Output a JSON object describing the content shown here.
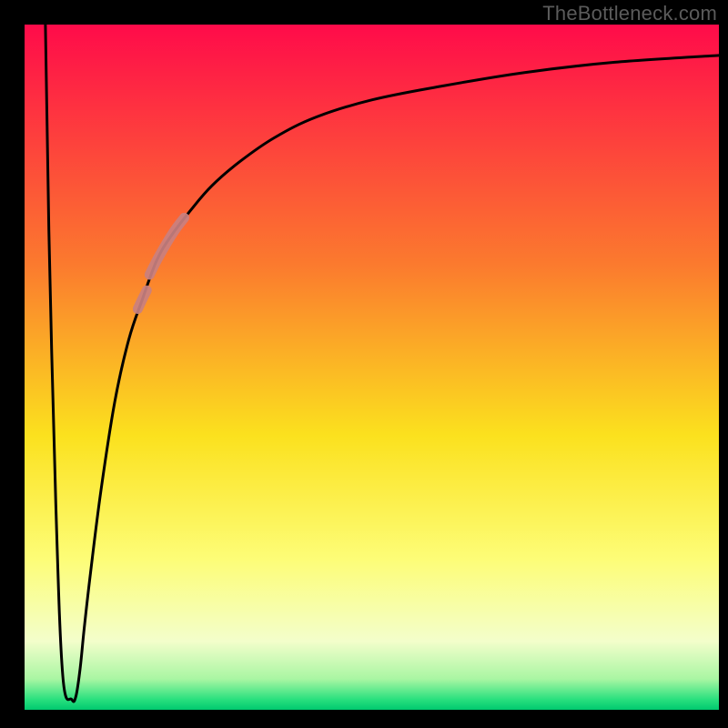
{
  "watermark": "TheBottleneck.com",
  "chart_data": {
    "type": "line",
    "title": "",
    "xlabel": "",
    "ylabel": "",
    "xlim": [
      0,
      100
    ],
    "ylim": [
      0,
      100
    ],
    "grid": false,
    "legend": false,
    "background_gradient_stops": [
      {
        "offset": 0.0,
        "color": "#ff0b4a"
      },
      {
        "offset": 0.35,
        "color": "#fb7a2e"
      },
      {
        "offset": 0.6,
        "color": "#fbe11e"
      },
      {
        "offset": 0.78,
        "color": "#fdfd77"
      },
      {
        "offset": 0.9,
        "color": "#f3fecb"
      },
      {
        "offset": 0.955,
        "color": "#a9f6a3"
      },
      {
        "offset": 0.985,
        "color": "#29e07e"
      },
      {
        "offset": 1.0,
        "color": "#00c96f"
      }
    ],
    "series": [
      {
        "name": "bottleneck-curve",
        "type": "line",
        "color": "#000000",
        "x": [
          3.0,
          3.5,
          4.5,
          5.5,
          6.8,
          7.4,
          8.0,
          8.6,
          9.5,
          11.0,
          13.0,
          15.0,
          17.0,
          19.0,
          21.0,
          24.0,
          27.0,
          31.0,
          36.0,
          42.0,
          50.0,
          60.0,
          72.0,
          85.0,
          100.0
        ],
        "y": [
          100.0,
          70.0,
          30.0,
          5.0,
          1.5,
          2.0,
          6.0,
          12.0,
          20.0,
          32.0,
          45.0,
          54.0,
          60.0,
          65.5,
          69.0,
          73.0,
          76.5,
          80.0,
          83.5,
          86.5,
          89.0,
          91.0,
          93.0,
          94.5,
          95.5
        ]
      },
      {
        "name": "highlight-segment-upper",
        "type": "line-thick",
        "color": "#c98080",
        "x": [
          18.0,
          19.0,
          20.0,
          21.0,
          22.0,
          23.0
        ],
        "y": [
          63.5,
          65.5,
          67.3,
          69.0,
          70.5,
          71.8
        ]
      },
      {
        "name": "highlight-segment-lower",
        "type": "line-thick",
        "color": "#c98080",
        "x": [
          16.3,
          17.0,
          17.6
        ],
        "y": [
          58.5,
          60.0,
          61.2
        ]
      }
    ]
  }
}
